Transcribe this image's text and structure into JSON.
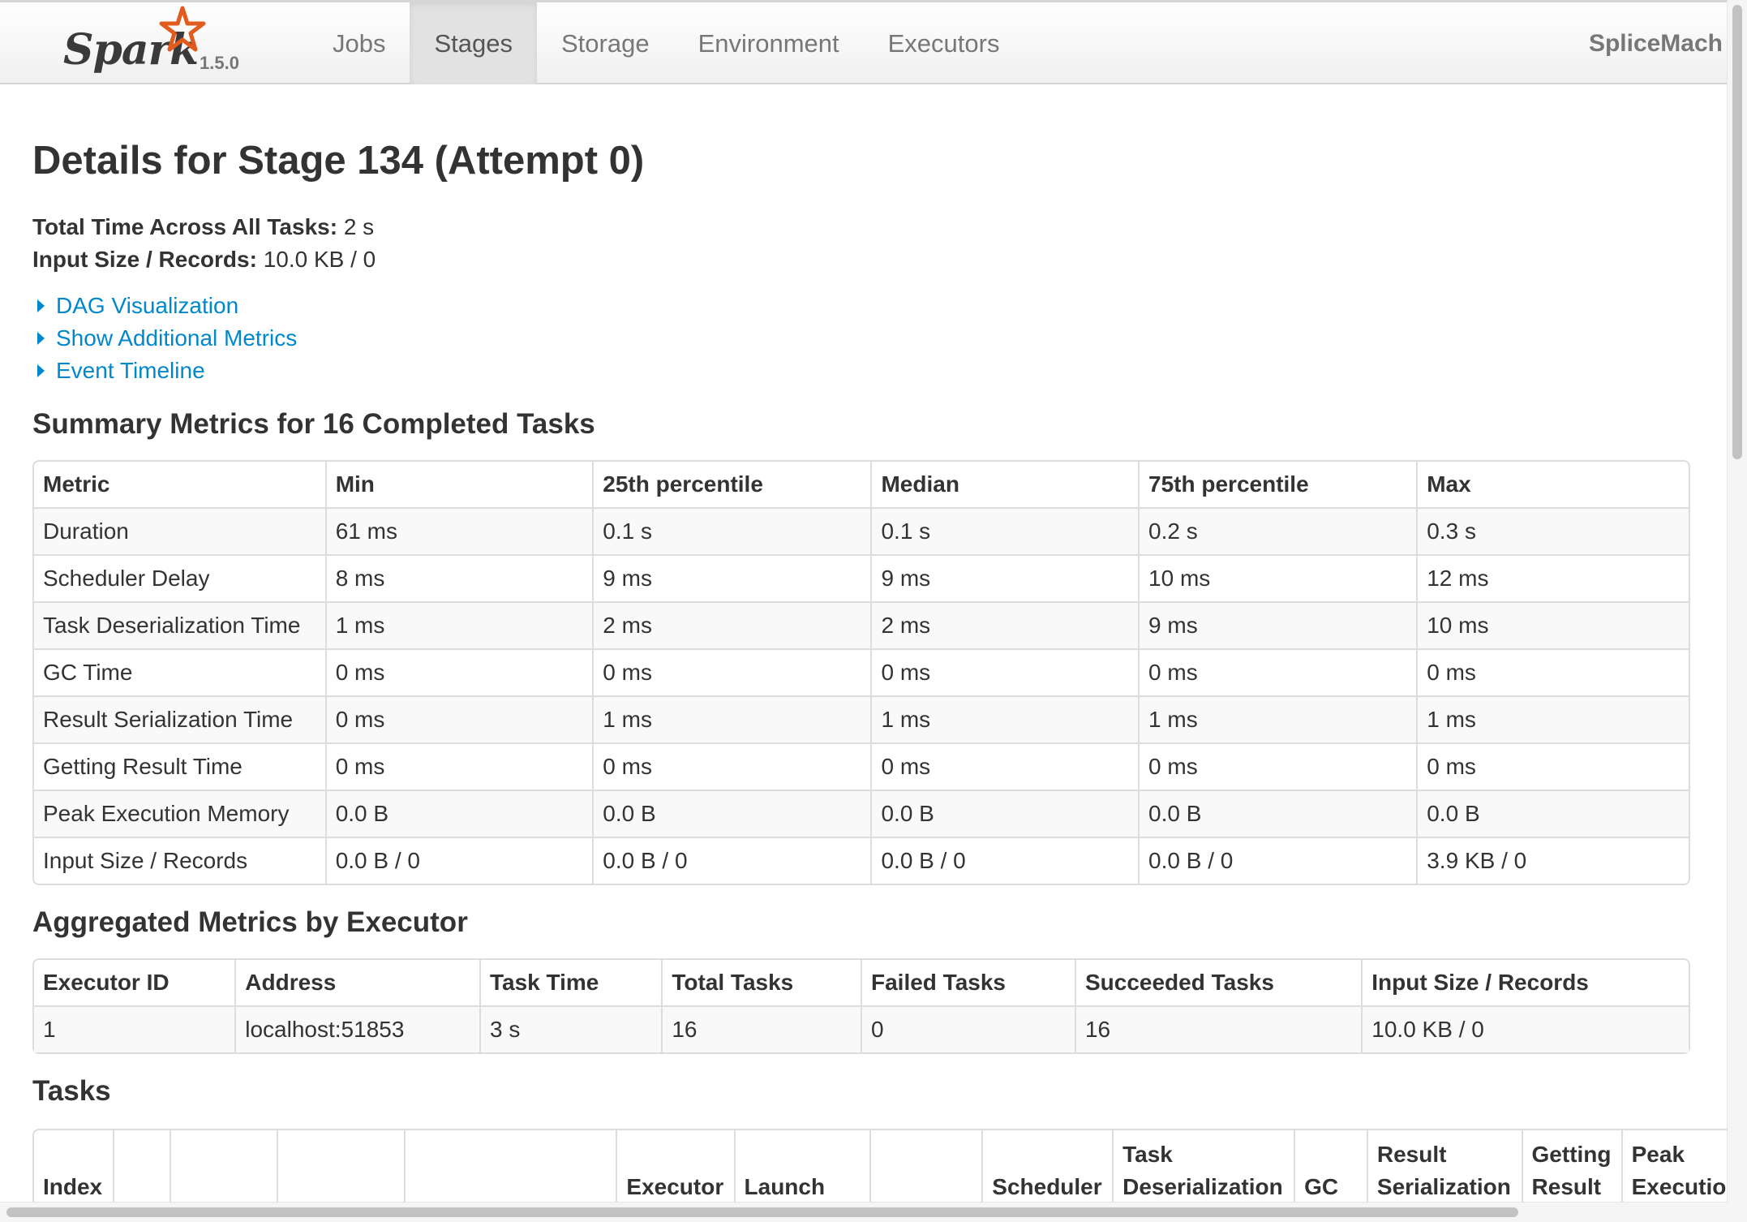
{
  "navbar": {
    "brand": "Spark",
    "version": "1.5.0",
    "tabs": [
      {
        "label": "Jobs",
        "active": false
      },
      {
        "label": "Stages",
        "active": true
      },
      {
        "label": "Storage",
        "active": false
      },
      {
        "label": "Environment",
        "active": false
      },
      {
        "label": "Executors",
        "active": false
      }
    ],
    "app_name": "SpliceMach"
  },
  "page_title": "Details for Stage 134 (Attempt 0)",
  "summary": {
    "total_time_label": "Total Time Across All Tasks:",
    "total_time_value": "2 s",
    "input_label": "Input Size / Records:",
    "input_value": "10.0 KB / 0"
  },
  "toggles": [
    "DAG Visualization",
    "Show Additional Metrics",
    "Event Timeline"
  ],
  "summary_metrics": {
    "title": "Summary Metrics for 16 Completed Tasks",
    "headers": [
      "Metric",
      "Min",
      "25th percentile",
      "Median",
      "75th percentile",
      "Max"
    ],
    "rows": [
      [
        "Duration",
        "61 ms",
        "0.1 s",
        "0.1 s",
        "0.2 s",
        "0.3 s"
      ],
      [
        "Scheduler Delay",
        "8 ms",
        "9 ms",
        "9 ms",
        "10 ms",
        "12 ms"
      ],
      [
        "Task Deserialization Time",
        "1 ms",
        "2 ms",
        "2 ms",
        "9 ms",
        "10 ms"
      ],
      [
        "GC Time",
        "0 ms",
        "0 ms",
        "0 ms",
        "0 ms",
        "0 ms"
      ],
      [
        "Result Serialization Time",
        "0 ms",
        "1 ms",
        "1 ms",
        "1 ms",
        "1 ms"
      ],
      [
        "Getting Result Time",
        "0 ms",
        "0 ms",
        "0 ms",
        "0 ms",
        "0 ms"
      ],
      [
        "Peak Execution Memory",
        "0.0 B",
        "0.0 B",
        "0.0 B",
        "0.0 B",
        "0.0 B"
      ],
      [
        "Input Size / Records",
        "0.0 B / 0",
        "0.0 B / 0",
        "0.0 B / 0",
        "0.0 B / 0",
        "3.9 KB / 0"
      ]
    ]
  },
  "executor_metrics": {
    "title": "Aggregated Metrics by Executor",
    "headers": [
      "Executor ID",
      "Address",
      "Task Time",
      "Total Tasks",
      "Failed Tasks",
      "Succeeded Tasks",
      "Input Size / Records"
    ],
    "rows": [
      [
        "1",
        "localhost:51853",
        "3 s",
        "16",
        "0",
        "16",
        "10.0 KB / 0"
      ]
    ]
  },
  "tasks": {
    "title": "Tasks",
    "headers": [
      [
        "",
        "Index"
      ],
      [
        "",
        ""
      ],
      [
        "",
        ""
      ],
      [
        "",
        ""
      ],
      [
        "",
        ""
      ],
      [
        "",
        "Executor"
      ],
      [
        "",
        "Launch"
      ],
      [
        "",
        ""
      ],
      [
        "",
        "Scheduler"
      ],
      [
        "Task",
        "Deserialization"
      ],
      [
        "",
        "GC"
      ],
      [
        "Result",
        "Serialization"
      ],
      [
        "Getting",
        "Result"
      ],
      [
        "Peak",
        "Execution"
      ]
    ]
  },
  "colors": {
    "link": "#0088cc",
    "active_tab_bg": "#e2e2e2",
    "table_border": "#dddddd",
    "stripe": "#f9f9f9",
    "spark_orange": "#e25a1c"
  },
  "icons": [
    "spark-star-icon",
    "caret-right-icon"
  ]
}
